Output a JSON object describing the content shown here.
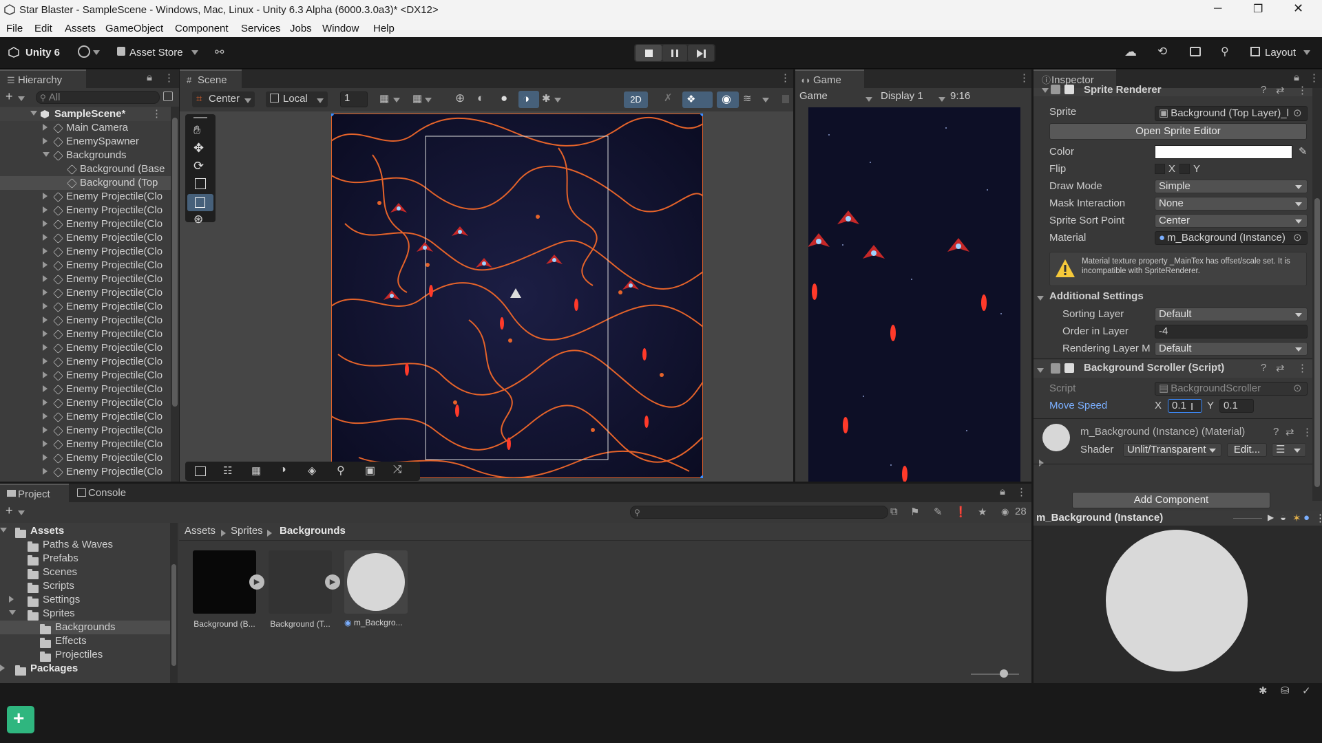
{
  "window": {
    "title": "Star Blaster - SampleScene - Windows, Mac, Linux - Unity 6.3 Alpha (6000.3.0a3)* <DX12>"
  },
  "menu": [
    "File",
    "Edit",
    "Assets",
    "GameObject",
    "Component",
    "Services",
    "Jobs",
    "Window",
    "Help"
  ],
  "toolbar": {
    "account": "Unity 6",
    "asset_store": "Asset Store",
    "layout": "Layout"
  },
  "hierarchy": {
    "tab": "Hierarchy",
    "search_placeholder": "All",
    "scene": "SampleScene*",
    "items": [
      {
        "label": "Main Camera",
        "indent": 1
      },
      {
        "label": "EnemySpawner",
        "indent": 1
      },
      {
        "label": "Backgrounds",
        "indent": 1
      },
      {
        "label": "Background (Base",
        "indent": 2
      },
      {
        "label": "Background (Top",
        "indent": 2
      },
      {
        "label": "Enemy Projectile(Clo",
        "indent": 1
      },
      {
        "label": "Enemy Projectile(Clo",
        "indent": 1
      },
      {
        "label": "Enemy Projectile(Clo",
        "indent": 1
      },
      {
        "label": "Enemy Projectile(Clo",
        "indent": 1
      },
      {
        "label": "Enemy Projectile(Clo",
        "indent": 1
      },
      {
        "label": "Enemy Projectile(Clo",
        "indent": 1
      },
      {
        "label": "Enemy Projectile(Clo",
        "indent": 1
      },
      {
        "label": "Enemy Projectile(Clo",
        "indent": 1
      },
      {
        "label": "Enemy Projectile(Clo",
        "indent": 1
      },
      {
        "label": "Enemy Projectile(Clo",
        "indent": 1
      },
      {
        "label": "Enemy Projectile(Clo",
        "indent": 1
      },
      {
        "label": "Enemy Projectile(Clo",
        "indent": 1
      },
      {
        "label": "Enemy Projectile(Clo",
        "indent": 1
      },
      {
        "label": "Enemy Projectile(Clo",
        "indent": 1
      },
      {
        "label": "Enemy Projectile(Clo",
        "indent": 1
      },
      {
        "label": "Enemy Projectile(Clo",
        "indent": 1
      },
      {
        "label": "Enemy Projectile(Clo",
        "indent": 1
      },
      {
        "label": "Enemy Projectile(Clo",
        "indent": 1
      },
      {
        "label": "Enemy Projectile(Clo",
        "indent": 1
      },
      {
        "label": "Enemy Projectile(Clo",
        "indent": 1
      },
      {
        "label": "Enemy Projectile(Clo",
        "indent": 1
      }
    ]
  },
  "scene": {
    "tab": "Scene",
    "pivot": "Center",
    "space": "Local",
    "grid_value": "1",
    "mode_2d": "2D"
  },
  "game": {
    "tab": "Game",
    "view": "Game",
    "display": "Display 1",
    "aspect": "9:16"
  },
  "inspector": {
    "tab": "Inspector",
    "sprite_renderer": {
      "header": "Sprite Renderer",
      "sprite_label": "Sprite",
      "sprite_value": "Background (Top Layer)_l",
      "open_editor": "Open Sprite Editor",
      "color_label": "Color",
      "flip_label": "Flip",
      "flip_x": "X",
      "flip_y": "Y",
      "draw_mode_label": "Draw Mode",
      "draw_mode": "Simple",
      "mask_label": "Mask Interaction",
      "mask": "None",
      "sort_point_label": "Sprite Sort Point",
      "sort_point": "Center",
      "material_label": "Material",
      "material": "m_Background (Instance)",
      "warning": "Material texture property _MainTex has offset/scale set. It is incompatible with SpriteRenderer.",
      "additional": "Additional Settings",
      "sorting_layer_label": "Sorting Layer",
      "sorting_layer": "Default",
      "order_label": "Order in Layer",
      "order": "-4",
      "rendering_layer_label": "Rendering Layer M",
      "rendering_layer": "Default"
    },
    "scroller": {
      "header": "Background Scroller (Script)",
      "script_label": "Script",
      "script": "BackgroundScroller",
      "speed_label": "Move Speed",
      "x_label": "X",
      "x": "0.1",
      "y_label": "Y",
      "y": "0.1"
    },
    "material": {
      "header": "m_Background (Instance) (Material)",
      "shader_label": "Shader",
      "shader": "Unlit/Transparent",
      "edit": "Edit..."
    },
    "add_component": "Add Component",
    "preview_title": "m_Background (Instance)"
  },
  "project": {
    "tabs": [
      "Project",
      "Console"
    ],
    "count": "28",
    "tree": [
      {
        "label": "Assets",
        "indent": 0,
        "bold": true
      },
      {
        "label": "Paths & Waves",
        "indent": 1
      },
      {
        "label": "Prefabs",
        "indent": 1
      },
      {
        "label": "Scenes",
        "indent": 1
      },
      {
        "label": "Scripts",
        "indent": 1
      },
      {
        "label": "Settings",
        "indent": 1
      },
      {
        "label": "Sprites",
        "indent": 1
      },
      {
        "label": "Backgrounds",
        "indent": 2
      },
      {
        "label": "Effects",
        "indent": 2
      },
      {
        "label": "Projectiles",
        "indent": 2
      },
      {
        "label": "Packages",
        "indent": 0,
        "bold": true
      }
    ],
    "breadcrumb": [
      "Assets",
      "Sprites",
      "Backgrounds"
    ],
    "assets": [
      "Background (B...",
      "Background (T...",
      "m_Backgro..."
    ]
  },
  "colors": {
    "accent": "#7bafff",
    "selection": "#2c5d87",
    "orange": "#e5632a"
  }
}
